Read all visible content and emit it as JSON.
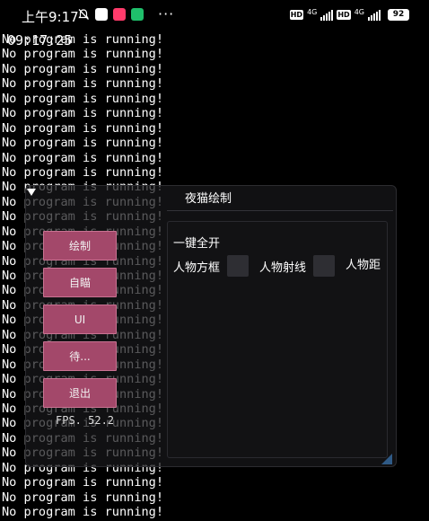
{
  "status_bar": {
    "time": "上午9:17",
    "more": "···",
    "hd1": "HD",
    "net1": "4G",
    "hd2": "HD",
    "net2": "4G",
    "battery": "92",
    "app_colors": [
      "#ffffff",
      "#ff3b6b",
      "#1fbf6b"
    ]
  },
  "console": {
    "overlay_time": "09:17:25",
    "lines": [
      "No program is running!",
      "No program is running!",
      "No program is running!",
      "No program is running!",
      "No program is running!",
      "No program is running!",
      "No program is running!",
      "No program is running!",
      "No program is running!",
      "No program is running!",
      "No program is running!",
      "No program is running!",
      "No program is running!",
      "No program is running!",
      "No program is running!",
      "No program is running!",
      "No program is running!",
      "No program is running!",
      "No program is running!",
      "No program is running!",
      "No program is running!",
      "No program is running!",
      "No program is running!",
      "No program is running!",
      "No program is running!",
      "No program is running!",
      "No program is running!",
      "No program is running!",
      "No program is running!",
      "No program is running!",
      "No program is running!",
      "No program is running!",
      "No program is running!"
    ]
  },
  "menu": {
    "title": "夜猫绘制",
    "buttons": {
      "draw": "绘制",
      "aim": "自瞄",
      "ui": "UI",
      "pending": "待...",
      "exit": "退出"
    },
    "fps": "FPS. 52.2",
    "all_on": "一键全开",
    "options": {
      "box": "人物方框",
      "line": "人物射线",
      "distance": "人物距"
    },
    "accent_color": "#a3486a"
  }
}
